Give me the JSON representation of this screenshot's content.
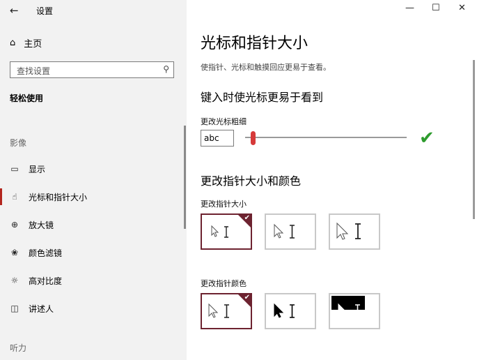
{
  "window": {
    "title": "设置",
    "minimize": "—",
    "maximize": "☐",
    "close": "✕"
  },
  "sidebar": {
    "home": "主页",
    "search_placeholder": "查找设置",
    "group": "轻松使用",
    "category_vision": "影像",
    "items": [
      {
        "label": "显示",
        "icon": "monitor-icon"
      },
      {
        "label": "光标和指针大小",
        "icon": "pointer-hand-icon",
        "active": true
      },
      {
        "label": "放大镜",
        "icon": "magnifier-icon"
      },
      {
        "label": "颜色滤镜",
        "icon": "palette-icon"
      },
      {
        "label": "高对比度",
        "icon": "contrast-icon"
      },
      {
        "label": "讲述人",
        "icon": "narrator-icon"
      }
    ],
    "category_hearing": "听力"
  },
  "main": {
    "title": "光标和指针大小",
    "subtitle": "使指针、光标和触摸回应更易于查看。",
    "section_cursor": "键入时使光标更易于看到",
    "cursor_thickness_label": "更改光标粗细",
    "cursor_preview_text": "abc",
    "cursor_thickness_value": 0.05,
    "section_pointer": "更改指针大小和颜色",
    "pointer_size_label": "更改指针大小",
    "pointer_color_label": "更改指针颜色",
    "accent_color": "#6d2330",
    "selected_size_index": 0,
    "selected_color_index": 0
  }
}
